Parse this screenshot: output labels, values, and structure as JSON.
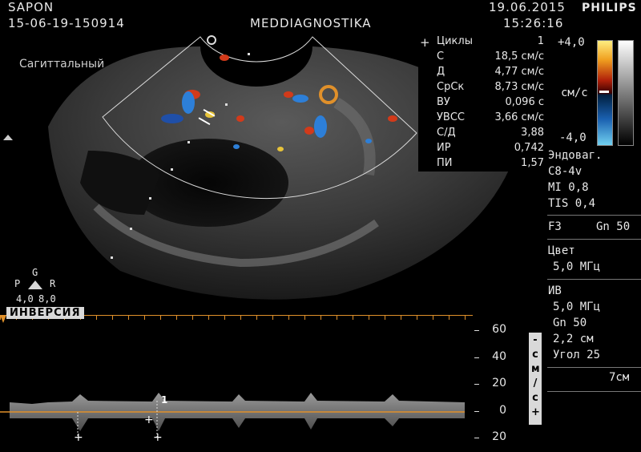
{
  "header": {
    "patient_name": "SAPON",
    "exam_id": "15-06-19-150914",
    "institution": "MEDDIAGNOSTIKA",
    "date": "19.06.2015",
    "time": "15:26:16",
    "brand": "PHILIPS"
  },
  "image": {
    "plane_label": "Сагиттальный",
    "orientation": {
      "top": "G",
      "left": "P",
      "right": "R",
      "scale_left": "4,0",
      "scale_right": "8,0"
    }
  },
  "measurements": {
    "rows": [
      {
        "label": "Циклы",
        "value": "1"
      },
      {
        "label": "С",
        "value": "18,5 см/с"
      },
      {
        "label": "Д",
        "value": "4,77 см/с"
      },
      {
        "label": "СрСк",
        "value": "8,73 см/с"
      },
      {
        "label": "ВУ",
        "value": "0,096 с"
      },
      {
        "label": "УВСС",
        "value": "3,66 см/с"
      },
      {
        "label": "С/Д",
        "value": "3,88"
      },
      {
        "label": "ИР",
        "value": "0,742"
      },
      {
        "label": "ПИ",
        "value": "1,57"
      }
    ],
    "marker": "+"
  },
  "color_scale": {
    "top": "+4,0",
    "unit": "см/с",
    "bottom": "-4,0"
  },
  "side_panel": {
    "probe": [
      "Эндоваг.",
      "C8-4v",
      "MI 0,8",
      "TIS 0,4"
    ],
    "preset": {
      "left": "F3",
      "right": "Gn 50"
    },
    "color": [
      "Цвет",
      "5,0 МГц"
    ],
    "pw": [
      "ИВ",
      "5,0 МГц",
      "Gn 50",
      "2,2 см",
      "Угол 25"
    ],
    "sweep": "7см"
  },
  "doppler": {
    "inversion_label": "ИНВЕРСИЯ",
    "scale_ticks": [
      "60",
      "40",
      "20",
      "0",
      "20"
    ],
    "unit_vertical": [
      "-",
      "с",
      "м",
      "/",
      "с",
      "+"
    ],
    "cursor_label": "1"
  },
  "colors": {
    "accent_orange": "#e0902a",
    "flow_red": "#d23a1a",
    "flow_blue": "#2d7fd8"
  }
}
